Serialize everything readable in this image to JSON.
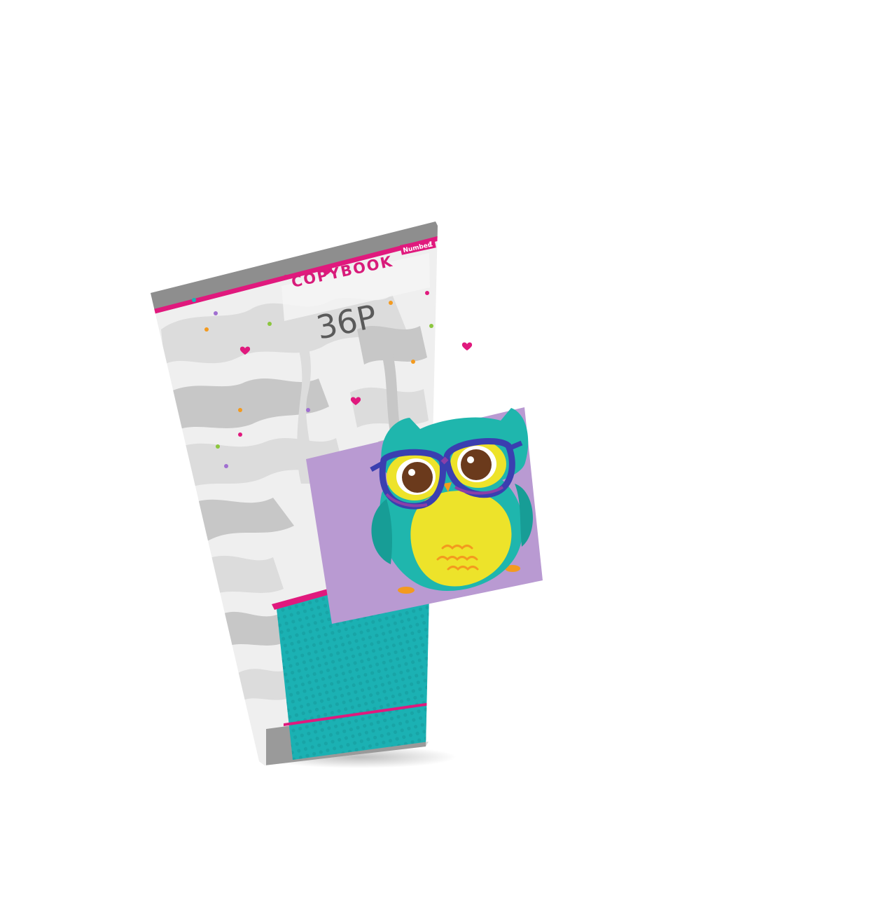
{
  "product": {
    "type": "copybook",
    "title_text": "COPYBOOK",
    "page_count_text": "36P",
    "brand_text": "Number1",
    "brand_label": "Number",
    "brand_mark": "1"
  },
  "colors": {
    "background": "#ffffff",
    "cover_base": "#efefef",
    "camo_light": "#dcdcdc",
    "camo_mid": "#c7c7c7",
    "spine_gray": "#8e8e8e",
    "accent_pink": "#e0197d",
    "accent_teal": "#1bb1b3",
    "owl_panel_purple": "#b99ad2",
    "owl_teal": "#1fb6ad",
    "owl_yellow": "#ede32a",
    "glasses_blue": "#3a3fb0",
    "glasses_purple": "#8b3fa8",
    "eye_brown": "#6b3a1c",
    "feather_orange": "#f39a1f",
    "title_text": "#d81b7a",
    "number_text": "#5a5a5a"
  },
  "decoration": {
    "illustration": "owl-with-glasses",
    "pattern": "gray-camouflage",
    "confetti": [
      "pink-heart",
      "pink-dot",
      "orange-dot",
      "green-dot",
      "purple-dot",
      "teal-dot"
    ]
  }
}
